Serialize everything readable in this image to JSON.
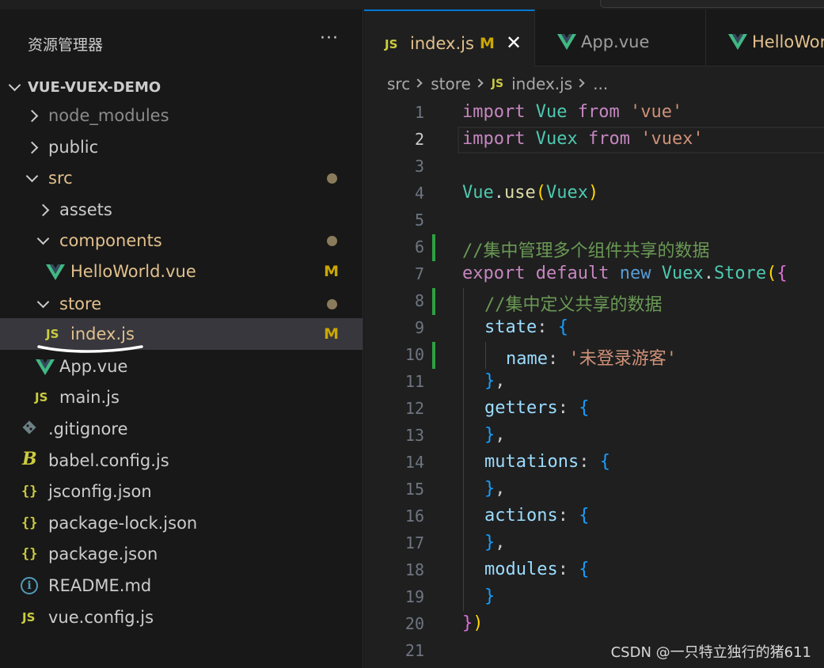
{
  "sidebar": {
    "title": "资源管理器",
    "more": "···",
    "root": "VUE-VUEX-DEMO",
    "items": [
      {
        "label": "node_modules",
        "badge": ""
      },
      {
        "label": "public",
        "badge": ""
      },
      {
        "label": "src",
        "badge": ""
      },
      {
        "label": "assets",
        "badge": ""
      },
      {
        "label": "components",
        "badge": ""
      },
      {
        "label": "HelloWorld.vue",
        "badge": "M"
      },
      {
        "label": "store",
        "badge": ""
      },
      {
        "label": "index.js",
        "badge": "M"
      },
      {
        "label": "App.vue",
        "badge": ""
      },
      {
        "label": "main.js",
        "badge": ""
      },
      {
        "label": ".gitignore",
        "badge": ""
      },
      {
        "label": "babel.config.js",
        "badge": ""
      },
      {
        "label": "jsconfig.json",
        "badge": ""
      },
      {
        "label": "package-lock.json",
        "badge": ""
      },
      {
        "label": "package.json",
        "badge": ""
      },
      {
        "label": "README.md",
        "badge": ""
      },
      {
        "label": "vue.config.js",
        "badge": ""
      }
    ]
  },
  "tabs": [
    {
      "label": "index.js",
      "badge": "M",
      "active": true
    },
    {
      "label": "App.vue"
    },
    {
      "label": "HelloWor"
    }
  ],
  "breadcrumb": {
    "parts": [
      "src",
      "store",
      "index.js",
      "..."
    ]
  },
  "icons": {
    "js": "JS",
    "json": "{}",
    "babel": "B",
    "info": "i"
  },
  "editor": {
    "line_numbers": [
      "1",
      "2",
      "3",
      "4",
      "5",
      "6",
      "7",
      "8",
      "9",
      "10",
      "11",
      "12",
      "13",
      "14",
      "15",
      "16",
      "17",
      "18",
      "19",
      "20",
      "21"
    ],
    "current_line": 2,
    "code": {
      "l1": [
        "import",
        "Vue",
        "from",
        "'vue'"
      ],
      "l2": [
        "import",
        "Vuex",
        "from",
        "'vuex'"
      ],
      "l4": [
        "Vue",
        ".",
        "use",
        "(",
        "Vuex",
        ")"
      ],
      "l6": "//集中管理多个组件共享的数据",
      "l7": [
        "export",
        "default",
        "new",
        "Vuex",
        ".",
        "Store",
        "(",
        "{"
      ],
      "l8": "//集中定义共享的数据",
      "l9": [
        "state",
        ":",
        "{"
      ],
      "l10": [
        "name",
        ":",
        "'未登录游客'"
      ],
      "l11": [
        "}",
        ","
      ],
      "l12": [
        "getters",
        ":",
        "{"
      ],
      "l13": [
        "}",
        ","
      ],
      "l14": [
        "mutations",
        ":",
        "{"
      ],
      "l15": [
        "}",
        ","
      ],
      "l16": [
        "actions",
        ":",
        "{"
      ],
      "l17": [
        "}",
        ","
      ],
      "l18": [
        "modules",
        ":",
        "{"
      ],
      "l19": [
        "}"
      ],
      "l20": [
        "}",
        ")"
      ]
    }
  },
  "watermark": "CSDN @一只特立独行的猪611",
  "colors": {
    "accent": "#0078d4",
    "modified": "#cca700",
    "vue_green": "#41b883",
    "js_yellow": "#cbcb41"
  }
}
